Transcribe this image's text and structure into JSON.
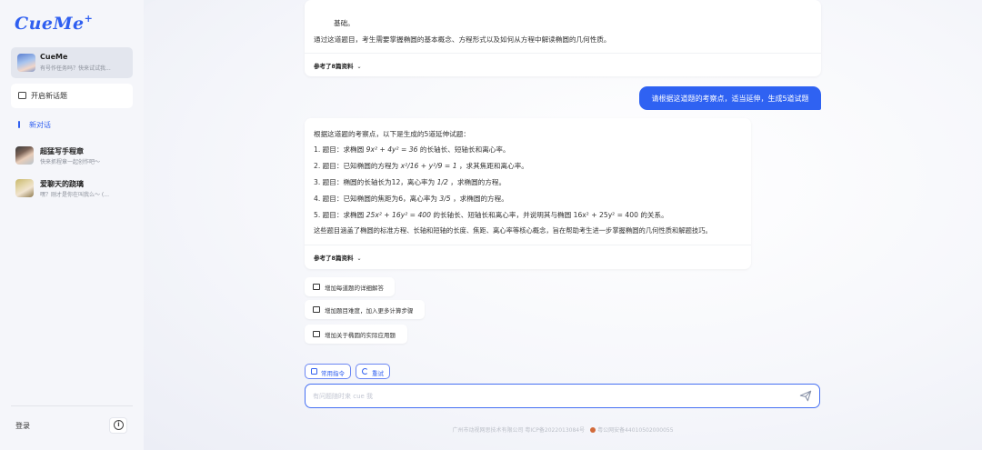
{
  "app": {
    "logo_text": "CueMe",
    "logo_mark": "+"
  },
  "sidebar": {
    "agent": {
      "name": "CueMe",
      "subtitle": "有号作任务吗？快来试试我..."
    },
    "new_topic_label": "开启新话题",
    "current_label": "新对话",
    "conversations": [
      {
        "title": "超猛写手程章",
        "subtitle": "快来抓程章一起创作吧～"
      },
      {
        "title": "爱聊天的跷璃",
        "subtitle": "嘿？刚才是你在叫我么～ (..."
      }
    ],
    "login_label": "登录",
    "info_icon": "i"
  },
  "chat": {
    "card1": {
      "line1": "基础。",
      "line2": "通过这道题目，考生需要掌握椭圆的基本概念、方程形式以及如何从方程中解读椭圆的几何性质。",
      "ref_label": "参考了8篇资料"
    },
    "user_message": "请根据这道题的考察点，适当延伸，生成5道试题",
    "card2": {
      "intro": "根据这道题的考察点，以下是生成的5道延伸试题：",
      "items": [
        {
          "num": "1.",
          "label": "题目：",
          "pre": "求椭圆 ",
          "math": "9x² + 4y² = 36",
          "post": " 的长轴长、短轴长和离心率。"
        },
        {
          "num": "2.",
          "label": "题目：",
          "pre": "已知椭圆的方程为 ",
          "math": "x²/16 + y²/9 = 1",
          "post": " ，求其焦距和离心率。"
        },
        {
          "num": "3.",
          "label": "题目：",
          "pre": "椭圆的长轴长为12，离心率为 ",
          "math": "1/2",
          "post": " ，求椭圆的方程。"
        },
        {
          "num": "4.",
          "label": "题目：",
          "pre": "已知椭圆的焦距为6，离心率为 ",
          "math": "3/5",
          "post": " ，求椭圆的方程。"
        },
        {
          "num": "5.",
          "label": "题目：",
          "pre": "求椭圆 ",
          "math": "25x² + 16y² = 400",
          "post": " 的长轴长、短轴长和离心率，并说明其与椭圆 16x² + 25y² = 400 的关系。"
        }
      ],
      "summary": "这些题目涵盖了椭圆的标准方程、长轴和短轴的长度、焦距、离心率等核心概念，旨在帮助考生进一步掌握椭圆的几何性质和解题技巧。",
      "ref_label": "参考了8篇资料"
    },
    "suggestions": [
      "增加每道题的详细解答",
      "增加题目难度，加入更多计算步骤",
      "增加关于椭圆的实际应用题"
    ]
  },
  "toolbar": {
    "common_cmd_label": "常用指令",
    "retry_label": "重试"
  },
  "input": {
    "placeholder": "有问题随时来 cue 我"
  },
  "footer": {
    "icp": "广州市动视网思技术有限公司 粤ICP备2022013084号",
    "police": "粤公网安备44010502000055"
  },
  "colors": {
    "accent": "#2f5ff0",
    "user_bubble": "#2f62f2"
  }
}
